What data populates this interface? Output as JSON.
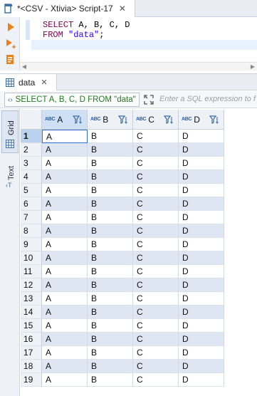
{
  "editor_tab": {
    "label": "*<CSV - Xtivia> Script-17",
    "close": "✕"
  },
  "sql": {
    "line1_kw": "SELECT",
    "line1_rest": " A, B, C, D",
    "line2_kw": "FROM",
    "line2_str": " \"data\"",
    "line2_end": ";"
  },
  "results_tab": {
    "label": "data",
    "close": "✕"
  },
  "filter": {
    "query": "SELECT A, B, C, D FROM \"data\"",
    "placeholder": "Enter a SQL expression to f"
  },
  "side_panel": {
    "grid_label": "Grid",
    "text_label": "Text"
  },
  "columns": [
    {
      "type_icon": "ABC",
      "name": "A"
    },
    {
      "type_icon": "ABC",
      "name": "B"
    },
    {
      "type_icon": "ABC",
      "name": "C"
    },
    {
      "type_icon": "ABC",
      "name": "D"
    }
  ],
  "rows": [
    {
      "n": "1",
      "v": [
        "A",
        "B",
        "C",
        "D"
      ]
    },
    {
      "n": "2",
      "v": [
        "A",
        "B",
        "C",
        "D"
      ]
    },
    {
      "n": "3",
      "v": [
        "A",
        "B",
        "C",
        "D"
      ]
    },
    {
      "n": "4",
      "v": [
        "A",
        "B",
        "C",
        "D"
      ]
    },
    {
      "n": "5",
      "v": [
        "A",
        "B",
        "C",
        "D"
      ]
    },
    {
      "n": "6",
      "v": [
        "A",
        "B",
        "C",
        "D"
      ]
    },
    {
      "n": "7",
      "v": [
        "A",
        "B",
        "C",
        "D"
      ]
    },
    {
      "n": "8",
      "v": [
        "A",
        "B",
        "C",
        "D"
      ]
    },
    {
      "n": "9",
      "v": [
        "A",
        "B",
        "C",
        "D"
      ]
    },
    {
      "n": "10",
      "v": [
        "A",
        "B",
        "C",
        "D"
      ]
    },
    {
      "n": "11",
      "v": [
        "A",
        "B",
        "C",
        "D"
      ]
    },
    {
      "n": "12",
      "v": [
        "A",
        "B",
        "C",
        "D"
      ]
    },
    {
      "n": "13",
      "v": [
        "A",
        "B",
        "C",
        "D"
      ]
    },
    {
      "n": "14",
      "v": [
        "A",
        "B",
        "C",
        "D"
      ]
    },
    {
      "n": "15",
      "v": [
        "A",
        "B",
        "C",
        "D"
      ]
    },
    {
      "n": "16",
      "v": [
        "A",
        "B",
        "C",
        "D"
      ]
    },
    {
      "n": "17",
      "v": [
        "A",
        "B",
        "C",
        "D"
      ]
    },
    {
      "n": "18",
      "v": [
        "A",
        "B",
        "C",
        "D"
      ]
    },
    {
      "n": "19",
      "v": [
        "A",
        "B",
        "C",
        "D"
      ]
    }
  ],
  "colors": {
    "accent": "#2c6fd6",
    "stripe": "#dde6f2",
    "header": "#eef1f5",
    "keyword": "#7f0055",
    "string": "#2a00ff",
    "query_text": "#1d7a1d"
  }
}
